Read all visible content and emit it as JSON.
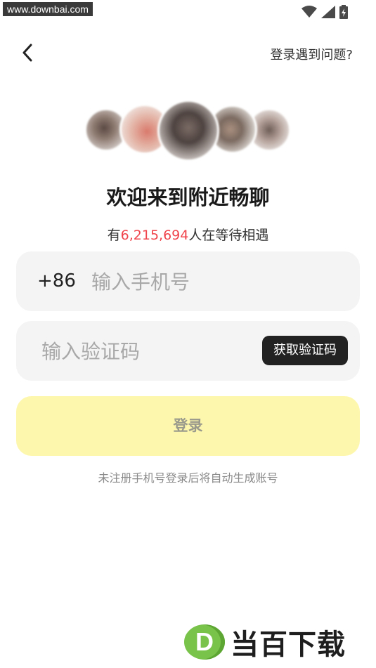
{
  "status_bar": {
    "watermark": "www.downbai.com",
    "icons": [
      "wifi-icon",
      "signal-icon",
      "battery-icon"
    ]
  },
  "header": {
    "back_icon": "chevron-left-icon",
    "help_label": "登录遇到问题?"
  },
  "welcome": {
    "title": "欢迎来到附近畅聊",
    "waiting_prefix": "有",
    "waiting_count": "6,215,694",
    "waiting_suffix": "人在等待相遇"
  },
  "phone_field": {
    "country_code": "+86",
    "placeholder": "输入手机号",
    "value": ""
  },
  "code_field": {
    "placeholder": "输入验证码",
    "value": "",
    "get_code_label": "获取验证码"
  },
  "login": {
    "label": "登录"
  },
  "note": "未注册手机号登录后将自动生成账号",
  "brand": {
    "mark": "D",
    "text": "当百下载"
  },
  "colors": {
    "accent_count": "#f0444c",
    "login_button": "#fdf7ad",
    "get_code_button": "#222222",
    "field_background": "#f4f4f4",
    "brand_green": "#79c34a"
  }
}
